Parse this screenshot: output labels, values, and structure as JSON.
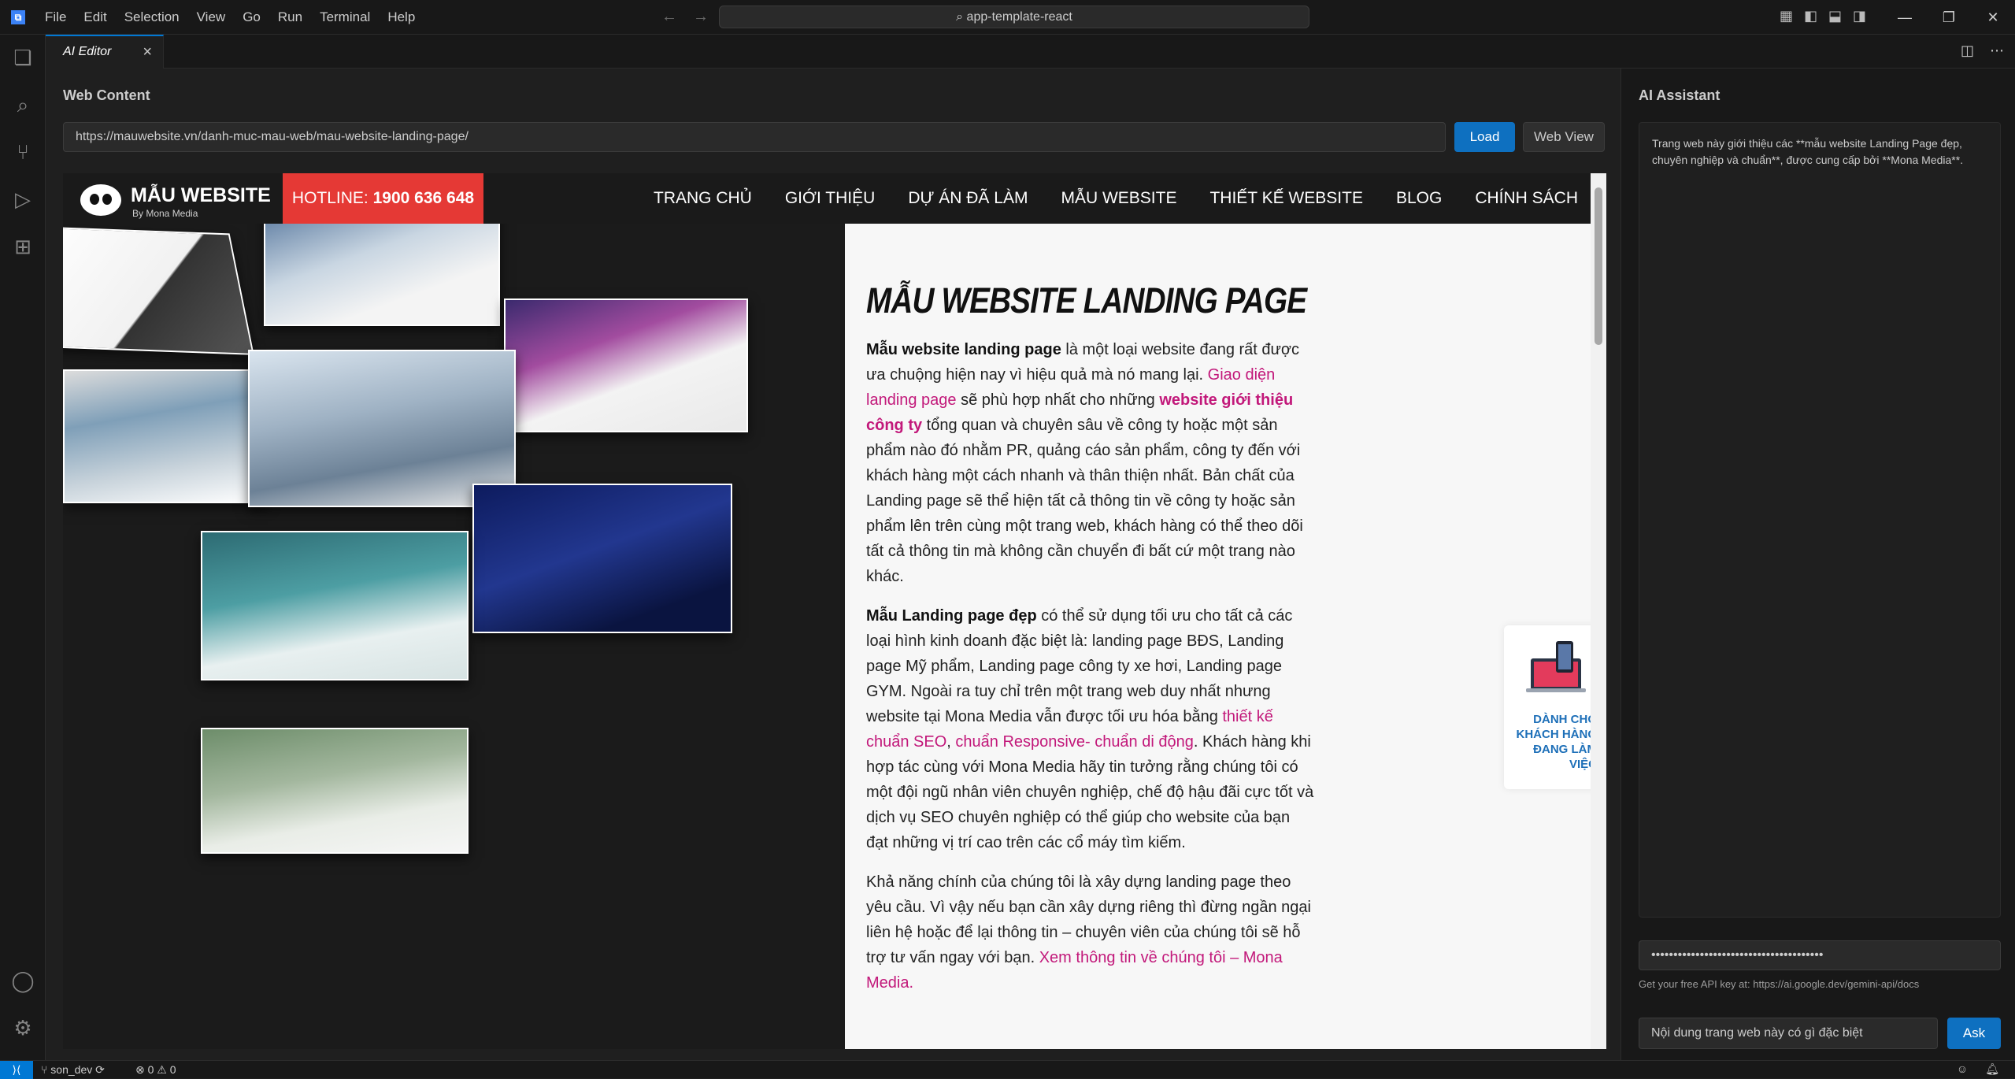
{
  "menu": [
    "File",
    "Edit",
    "Selection",
    "View",
    "Go",
    "Run",
    "Terminal",
    "Help"
  ],
  "command_center": "app-template-react",
  "editor_tab": "AI Editor",
  "web_content": {
    "title": "Web Content",
    "url": "https://mauwebsite.vn/danh-muc-mau-web/mau-website-landing-page/",
    "load_label": "Load",
    "webview_label": "Web View"
  },
  "site": {
    "logo_name": "MẪU WEBSITE",
    "logo_by": "By Mona Media",
    "hotline_label": "HOTLINE:",
    "hotline_number": "1900 636 648",
    "nav": [
      "TRANG CHỦ",
      "GIỚI THIỆU",
      "DỰ ÁN ĐÃ LÀM",
      "MẪU WEBSITE",
      "THIẾT KẾ WEBSITE",
      "BLOG",
      "CHÍNH SÁCH"
    ],
    "heading": "MẪU WEBSITE LANDING PAGE",
    "p1": {
      "b1": "Mẫu website landing page",
      "t1": " là một loại website đang rất được ưa chuộng hiện nay vì hiệu quả mà nó mang lại. ",
      "link1": "Giao diện landing page",
      "t2": " sẽ phù hợp nhất cho những ",
      "link2": "website giới thiệu công ty",
      "t3": " tổng quan và chuyên sâu về công ty hoặc một sản phẩm nào đó nhằm PR, quảng cáo sản phẩm, công ty đến với khách hàng một cách nhanh và thân thiện nhất. Bản chất của Landing page sẽ thể hiện tất cả thông tin về công ty hoặc sản phẩm lên trên cùng một trang web, khách hàng có thể theo dõi tất cả thông tin mà không cần chuyển đi bất cứ một trang nào khác."
    },
    "p2": {
      "b1": "Mẫu Landing page đẹp",
      "t1": " có thể sử dụng tối ưu cho tất cả các loại hình kinh doanh đặc biệt là: landing page BĐS, Landing page Mỹ phẩm, Landing page công ty xe hơi, Landing page GYM. Ngoài ra tuy chỉ trên một trang web duy nhất nhưng website tại Mona Media vẫn được tối ưu hóa bằng ",
      "link1": "thiết kế chuẩn SEO",
      "t2": ", ",
      "link2": "chuẩn Responsive- chuẩn di động",
      "t3": ". Khách hàng khi hợp tác cùng với Mona Media hãy tin tưởng rằng chúng tôi có một đội ngũ nhân viên chuyên nghiệp, chế độ hậu đãi cực tốt và dịch vụ SEO chuyên nghiệp có thể giúp cho website của bạn đạt những vị trí cao trên các cổ máy tìm kiếm."
    },
    "p3": {
      "t1": "Khả năng chính của chúng tôi là xây dựng landing page theo yêu cầu. Vì vậy nếu bạn cần xây dựng riêng thì đừng ngần ngại liên hệ hoặc để lại thông tin – chuyên viên của chúng tôi sẽ hỗ trợ tư vấn ngay với bạn. ",
      "link1": "Xem thông tin về chúng tôi – Mona Media",
      "t2": "."
    },
    "side_card": "DÀNH CHO KHÁCH HÀNG ĐANG LÀM VIỆC"
  },
  "ai": {
    "title": "AI Assistant",
    "response": "Trang web này giới thiệu các **mẫu website Landing Page đẹp, chuyên nghiệp và chuẩn**, được cung cấp bởi **Mona Media**.",
    "api_key_masked": "•••••••••••••••••••••••••••••••••••••••",
    "api_hint": "Get your free API key at: https://ai.google.dev/gemini-api/docs",
    "question": "Nội dung trang web này có gì đặc biệt",
    "ask_label": "Ask"
  },
  "status": {
    "branch": "son_dev",
    "problems": "⊗ 0 ⚠ 0"
  },
  "colors": {
    "accent": "#0078d4",
    "button_blue": "#0e70c0",
    "hotline_red": "#e53935",
    "link_magenta": "#c2187a",
    "card_blue": "#1d6fb8"
  }
}
